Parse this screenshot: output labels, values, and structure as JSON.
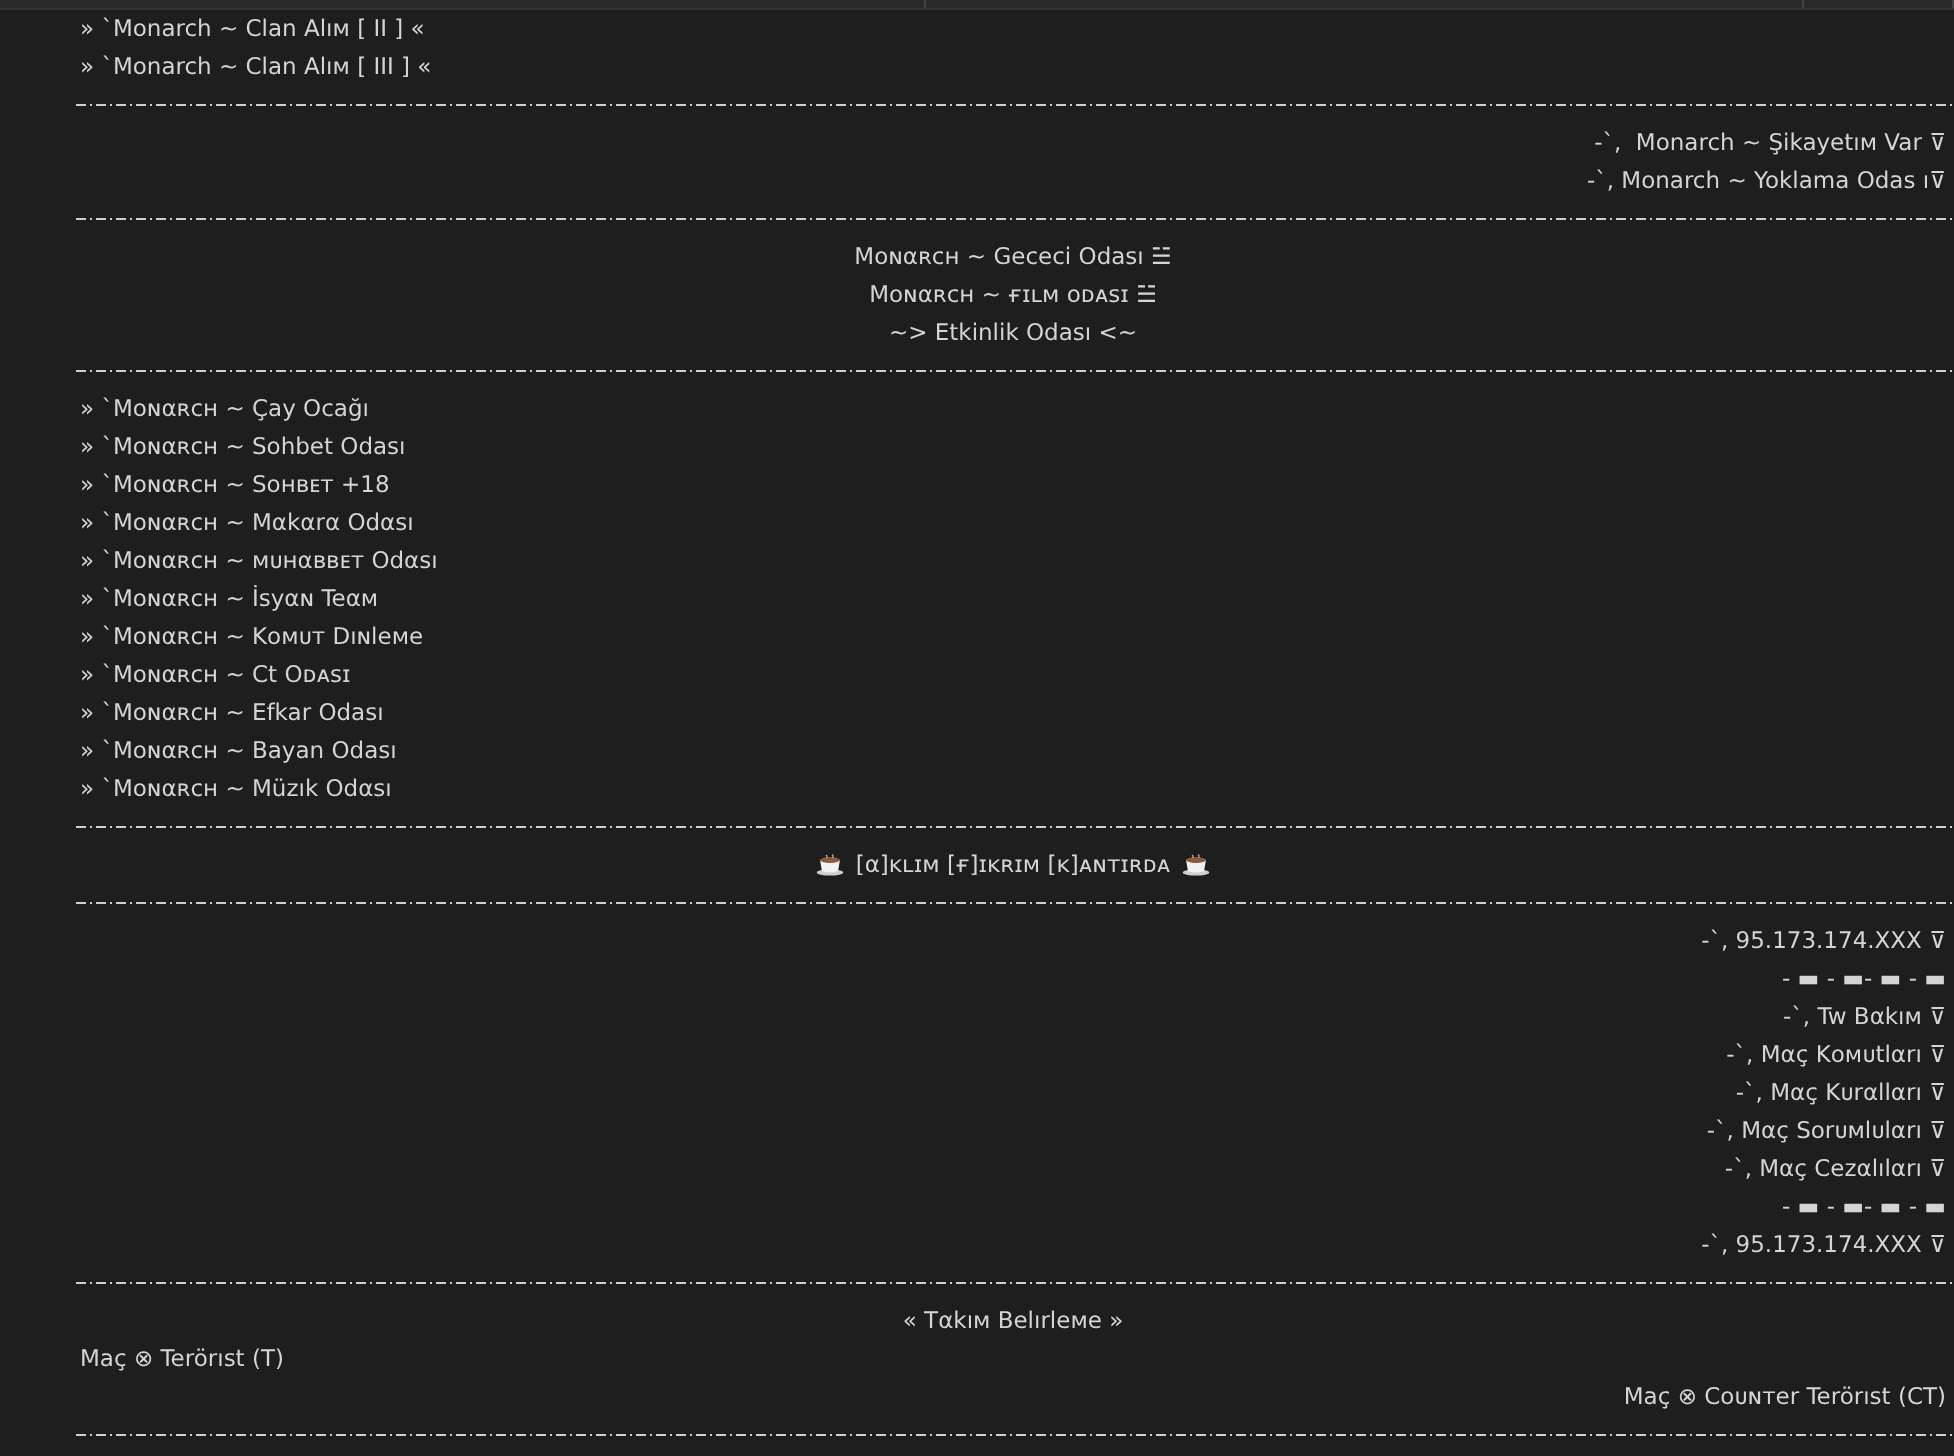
{
  "channels": [
    {
      "kind": "channel",
      "name": "» `Monarch ~ Clan Alıᴍ [ II ] «"
    },
    {
      "kind": "channel",
      "name": "» `Monarch ~ Clan Alıᴍ [ III ] «"
    },
    {
      "kind": "line"
    },
    {
      "kind": "right",
      "name": "-`,  Monarch ~ Şikayetıᴍ Var ⊽"
    },
    {
      "kind": "right",
      "name": "-`, Monarch ~ Yoklama Odas ı⊽"
    },
    {
      "kind": "line"
    },
    {
      "kind": "center",
      "name": "Mᴏɴαʀᴄʜ ~ Gececi Odası ☱"
    },
    {
      "kind": "center",
      "name": "Mᴏɴαʀᴄʜ ~ ғɪʟᴍ ᴏᴅᴀsɪ ☱"
    },
    {
      "kind": "center",
      "name": "~> Etkinlik Odası <~"
    },
    {
      "kind": "line"
    },
    {
      "kind": "channel",
      "name": "» `Mᴏɴαʀᴄʜ ~ Çay Ocağı"
    },
    {
      "kind": "channel",
      "name": "» `Mᴏɴαʀᴄʜ ~ Sohbet Odası"
    },
    {
      "kind": "channel",
      "name": "» `Mᴏɴαʀᴄʜ ~ Sᴏʜʙᴇᴛ +18"
    },
    {
      "kind": "channel",
      "name": "» `Mᴏɴαʀᴄʜ ~ Mαkαrα Odαsı"
    },
    {
      "kind": "channel",
      "name": "» `Mᴏɴαʀᴄʜ ~ ᴍᴜʜαʙʙᴇᴛ Odαsı"
    },
    {
      "kind": "channel",
      "name": "» `Mᴏɴαʀᴄʜ ~ İsyαɴ Teαᴍ"
    },
    {
      "kind": "channel",
      "name": "» `Mᴏɴαʀᴄʜ ~ Kᴏᴍᴜᴛ Dıɴleᴍe"
    },
    {
      "kind": "channel",
      "name": "» `Mᴏɴαʀᴄʜ ~ Ct Oᴅᴀsɪ"
    },
    {
      "kind": "channel",
      "name": "» `Mᴏɴαʀᴄʜ ~ Efkar Odası"
    },
    {
      "kind": "channel",
      "name": "» `Mᴏɴαʀᴄʜ ~ Bayan Odası"
    },
    {
      "kind": "channel",
      "name": "» `Mᴏɴαʀᴄʜ ~ Müzık Odαsı"
    },
    {
      "kind": "line"
    },
    {
      "kind": "banner",
      "name": "[α]ᴋʟɪᴍ [ғ]ɪᴋʀɪᴍ [ᴋ]ᴀɴᴛɪʀᴅᴀ"
    },
    {
      "kind": "line"
    },
    {
      "kind": "right",
      "name": "-`, 95.173.174.XXX ⊽"
    },
    {
      "kind": "right",
      "name": "- ▬ - ▬- ▬ - ▬"
    },
    {
      "kind": "right",
      "name": "-`, Tw Bαkıᴍ ⊽"
    },
    {
      "kind": "right",
      "name": "-`, Mαç Kᴏᴍᴜtlαrı ⊽"
    },
    {
      "kind": "right",
      "name": "-`, Mαç Kᴜrαllαrı ⊽"
    },
    {
      "kind": "right",
      "name": "-`, Mαç Sᴏrᴜᴍlᴜlαrı ⊽"
    },
    {
      "kind": "right",
      "name": "-`, Mαç Cezαlılαrı ⊽"
    },
    {
      "kind": "right",
      "name": "- ▬ - ▬- ▬ - ▬"
    },
    {
      "kind": "right",
      "name": "-`, 95.173.174.XXX ⊽"
    },
    {
      "kind": "line"
    },
    {
      "kind": "center",
      "name": "« Tαkıᴍ Belırleᴍe »"
    },
    {
      "kind": "channel",
      "name": "Maç ⊗ Terörıst (T)"
    },
    {
      "kind": "right",
      "name": "Maç ⊗ Cᴏᴜɴᴛer Terörıst (CT)"
    },
    {
      "kind": "line"
    }
  ]
}
